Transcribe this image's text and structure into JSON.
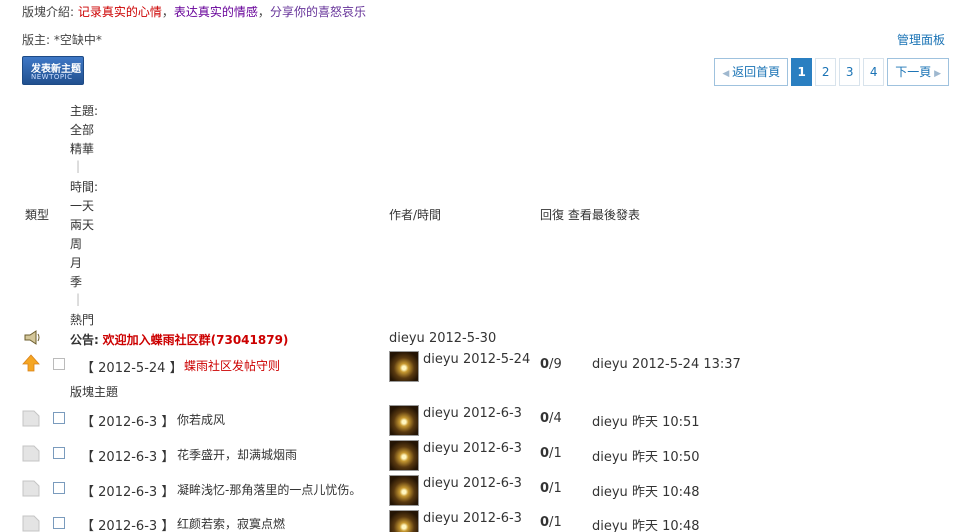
{
  "forum": {
    "intro_label": "版塊介紹:",
    "intro_part1": "记录真实的心情",
    "intro_part2": "表达真实的情感",
    "intro_part3": "分享你的喜怒哀乐",
    "moderator_label": "版主:",
    "moderator_value": "*空缺中*",
    "manage_link": "管理面板"
  },
  "new_topic_button": {
    "text_cn": "发表新主题",
    "text_en": "NEWTOPIC"
  },
  "pagination": {
    "back": "返回首頁",
    "pages": [
      "1",
      "2",
      "3",
      "4"
    ],
    "current": "1",
    "next": "下一頁"
  },
  "columns": {
    "type": "類型",
    "author_time": "作者/時間",
    "reply_view": "回復 查看",
    "last_post": "最後發表"
  },
  "filters": {
    "topic_label": "主題:",
    "all": "全部",
    "digest": "精華",
    "separator": "|",
    "time_label": "時間:",
    "day": "一天",
    "two_days": "兩天",
    "week": "周",
    "month": "月",
    "season": "季",
    "hot": "熱門"
  },
  "announcement": {
    "label": "公告:",
    "title": "欢迎加入蝶雨社区群(73041879)",
    "author": "dieyu",
    "date": "2012-5-30"
  },
  "section_label": "版塊主題",
  "threads": [
    {
      "date": "2012-5-24",
      "title": "蝶雨社区发帖守则",
      "author": "dieyu",
      "post_date": "2012-5-24",
      "replies": "0",
      "views": "9",
      "last_author": "dieyu",
      "last_time": "2012-5-24 13:37"
    },
    {
      "date": "2012-6-3",
      "title": "你若成风",
      "author": "dieyu",
      "post_date": "2012-6-3",
      "replies": "0",
      "views": "4",
      "last_author": "dieyu",
      "last_time": "昨天 10:51"
    },
    {
      "date": "2012-6-3",
      "title": "花季盛开，却满城烟雨",
      "author": "dieyu",
      "post_date": "2012-6-3",
      "replies": "0",
      "views": "1",
      "last_author": "dieyu",
      "last_time": "昨天 10:50"
    },
    {
      "date": "2012-6-3",
      "title": "凝眸浅忆-那角落里的一点儿忧伤。",
      "author": "dieyu",
      "post_date": "2012-6-3",
      "replies": "0",
      "views": "1",
      "last_author": "dieyu",
      "last_time": "昨天 10:48"
    },
    {
      "date": "2012-6-3",
      "title": "红颜若索，寂寞点燃",
      "author": "dieyu",
      "post_date": "2012-6-3",
      "replies": "0",
      "views": "1",
      "last_author": "dieyu",
      "last_time": "昨天 10:48"
    }
  ],
  "brackets": {
    "open": "【",
    "close": "】"
  },
  "colors": {
    "link_blue": "#1a73b5",
    "alert_red": "#cc0000",
    "pager_active": "#2a7fc1"
  }
}
